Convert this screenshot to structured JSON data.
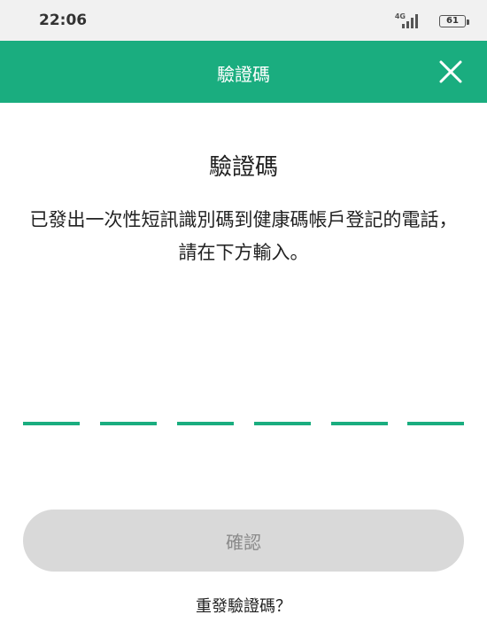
{
  "status_bar": {
    "time": "22:06",
    "network": "4G",
    "battery": "61"
  },
  "header": {
    "title": "驗證碼",
    "close_icon": "close-icon",
    "background_color": "#1aad7f"
  },
  "main": {
    "title": "驗證碼",
    "description": "已發出一次性短訊識別碼到健康碼帳戶登記的電話，請在下方輸入。",
    "otp_digits": [
      "",
      "",
      "",
      "",
      "",
      ""
    ],
    "underline_color": "#1aad7f"
  },
  "actions": {
    "confirm_label": "確認",
    "resend_label": "重發驗證碼？"
  }
}
